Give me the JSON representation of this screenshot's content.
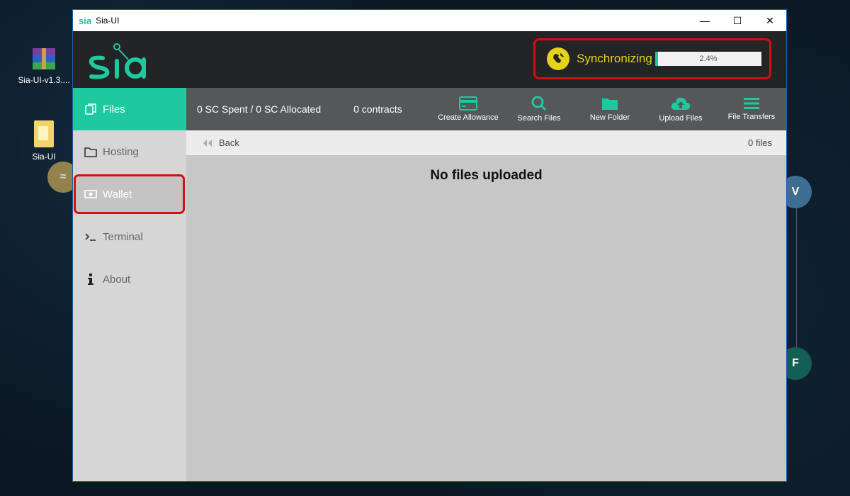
{
  "desktop": {
    "icons": [
      {
        "label": "Sia-UI-v1.3...."
      },
      {
        "label": "Sia-UI"
      }
    ],
    "coin_letters": [
      "V",
      "F"
    ]
  },
  "window": {
    "logo_small": "sia",
    "title": "Sia-UI",
    "controls": {
      "minimize": "—",
      "maximize": "☐",
      "close": "✕"
    }
  },
  "header": {
    "logo": "sia",
    "sync_label": "Synchronizing",
    "progress_text": "2.4%",
    "progress_value": 2.4,
    "accent": "#1ec9a0",
    "sync_color": "#e6d21a",
    "highlight_color": "#d40f12"
  },
  "sidebar": {
    "items": [
      {
        "label": "Files",
        "icon": "files-icon"
      },
      {
        "label": "Hosting",
        "icon": "folder-icon"
      },
      {
        "label": "Wallet",
        "icon": "wallet-icon"
      },
      {
        "label": "Terminal",
        "icon": "terminal-icon"
      },
      {
        "label": "About",
        "icon": "info-icon"
      }
    ]
  },
  "toolbar": {
    "spent": "0 SC Spent / 0 SC Allocated",
    "contracts": "0 contracts",
    "actions": [
      {
        "label": "Create Allowance",
        "icon": "credit-card-icon"
      },
      {
        "label": "Search Files",
        "icon": "search-icon"
      },
      {
        "label": "New Folder",
        "icon": "folder-icon"
      },
      {
        "label": "Upload Files",
        "icon": "cloud-upload-icon"
      },
      {
        "label": "File Transfers",
        "icon": "menu-icon"
      }
    ]
  },
  "browser": {
    "back_label": "Back",
    "file_count": "0 files",
    "empty_message": "No files uploaded"
  }
}
